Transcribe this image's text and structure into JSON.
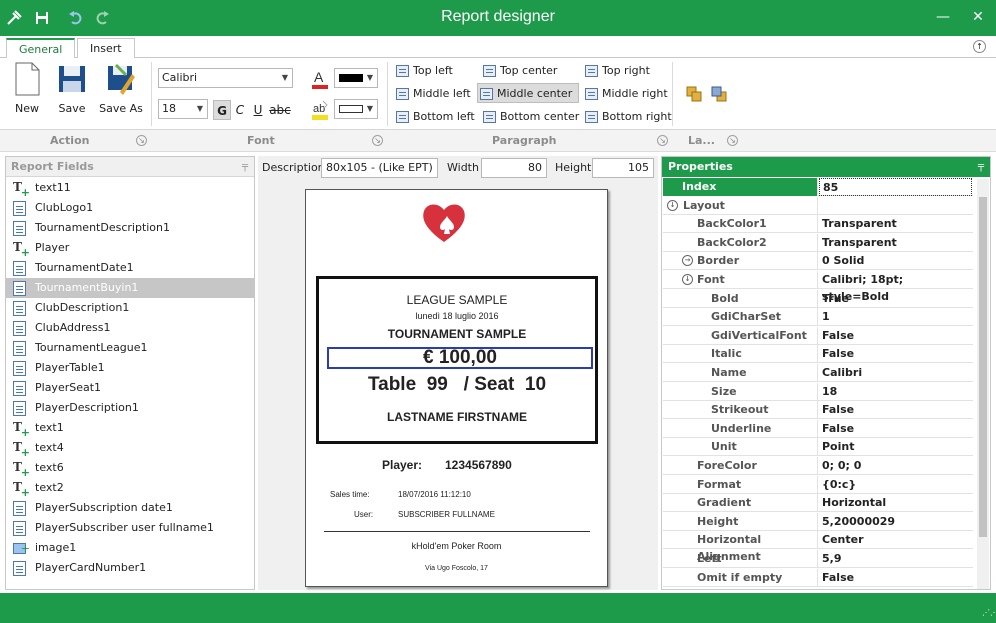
{
  "window": {
    "title": "Report designer"
  },
  "tabs": [
    {
      "label": "General"
    },
    {
      "label": "Insert"
    }
  ],
  "ribbon": {
    "new_label": "New",
    "save_label": "Save",
    "saveas_label": "Save As",
    "font_name": "Calibri",
    "font_size": "18",
    "bold": "G",
    "italic": "C",
    "underline": "U",
    "strike": "abc",
    "align": {
      "top_left": "Top left",
      "top_center": "Top center",
      "top_right": "Top right",
      "middle_left": "Middle left",
      "middle_center": "Middle center",
      "middle_right": "Middle right",
      "bottom_left": "Bottom left",
      "bottom_center": "Bottom center",
      "bottom_right": "Bottom right"
    },
    "groups": {
      "action": "Action",
      "font": "Font",
      "paragraph": "Paragraph",
      "layout": "La..."
    },
    "colors": {
      "font_color": "#000000",
      "back_color": "#ffffff"
    }
  },
  "report_fields": {
    "header": "Report Fields",
    "items": [
      {
        "label": "text11",
        "icon": "text-field-icon"
      },
      {
        "label": "ClubLogo1",
        "icon": "document-icon"
      },
      {
        "label": "TournamentDescription1",
        "icon": "document-icon"
      },
      {
        "label": "Player",
        "icon": "text-field-icon"
      },
      {
        "label": "TournamentDate1",
        "icon": "document-icon"
      },
      {
        "label": "TournamentBuyin1",
        "icon": "document-icon",
        "selected": true
      },
      {
        "label": "ClubDescription1",
        "icon": "document-icon"
      },
      {
        "label": "ClubAddress1",
        "icon": "document-icon"
      },
      {
        "label": "TournamentLeague1",
        "icon": "document-icon"
      },
      {
        "label": "PlayerTable1",
        "icon": "document-icon"
      },
      {
        "label": "PlayerSeat1",
        "icon": "document-icon"
      },
      {
        "label": "PlayerDescription1",
        "icon": "document-icon"
      },
      {
        "label": "text1",
        "icon": "text-field-icon"
      },
      {
        "label": "text4",
        "icon": "text-field-icon"
      },
      {
        "label": "text6",
        "icon": "text-field-icon"
      },
      {
        "label": "text2",
        "icon": "text-field-icon"
      },
      {
        "label": "PlayerSubscription date1",
        "icon": "document-icon"
      },
      {
        "label": "PlayerSubscriber user fullname1",
        "icon": "document-icon"
      },
      {
        "label": "image1",
        "icon": "image-icon"
      },
      {
        "label": "PlayerCardNumber1",
        "icon": "document-icon"
      }
    ]
  },
  "dimensions": {
    "description_label": "Description",
    "description_value": "80x105 - (Like EPT)",
    "width_label": "Width",
    "width_value": "80",
    "height_label": "Height",
    "height_value": "105"
  },
  "ticket": {
    "league": "LEAGUE SAMPLE",
    "date": "lunedì 18 luglio 2016",
    "tournament": "TOURNAMENT SAMPLE",
    "buyin": "€ 100,00",
    "table_seat": "Table  99   / Seat  10",
    "name": "LASTNAME FIRSTNAME",
    "player_label": "Player:",
    "player_number": "1234567890",
    "sales_label": "Sales time:",
    "sales_value": "18/07/2016 11:12:10",
    "user_label": "User:",
    "user_value": "SUBSCRIBER FULLNAME",
    "room": "kHold'em Poker Room",
    "address": "Via Ugo Foscolo, 17"
  },
  "properties": {
    "header": "Properties",
    "rows": [
      {
        "name": "Index",
        "value": "85"
      },
      {
        "name": "Layout",
        "value": ""
      },
      {
        "name": "BackColor1",
        "value": "Transparent"
      },
      {
        "name": "BackColor2",
        "value": "Transparent"
      },
      {
        "name": "Border",
        "value": "0 Solid"
      },
      {
        "name": "Font",
        "value": "Calibri; 18pt; style=Bold"
      },
      {
        "name": "Bold",
        "value": "True"
      },
      {
        "name": "GdiCharSet",
        "value": "1"
      },
      {
        "name": "GdiVerticalFont",
        "value": "False"
      },
      {
        "name": "Italic",
        "value": "False"
      },
      {
        "name": "Name",
        "value": "Calibri"
      },
      {
        "name": "Size",
        "value": "18"
      },
      {
        "name": "Strikeout",
        "value": "False"
      },
      {
        "name": "Underline",
        "value": "False"
      },
      {
        "name": "Unit",
        "value": "Point"
      },
      {
        "name": "ForeColor",
        "value": "0; 0; 0"
      },
      {
        "name": "Format",
        "value": "{0:c}"
      },
      {
        "name": "Gradient",
        "value": "Horizontal"
      },
      {
        "name": "Height",
        "value": "5,20000029"
      },
      {
        "name": "Horizontal Alignment",
        "value": "Center"
      },
      {
        "name": "Left",
        "value": "5,9"
      },
      {
        "name": "Omit if empty",
        "value": "False"
      }
    ]
  },
  "accent_color": "#1d9b4b"
}
